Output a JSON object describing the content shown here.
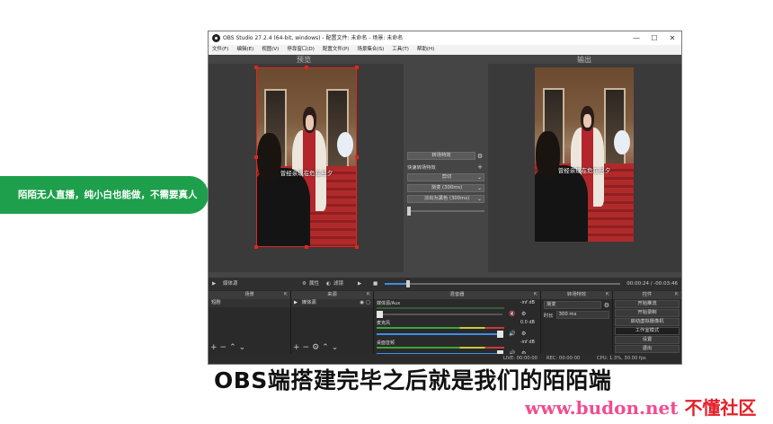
{
  "banner": {
    "text": "陌陌无人直播，纯小白也能做，不需要真人"
  },
  "window": {
    "title": "OBS Studio 27.2.4 (64-bit, windows) - 配置文件: 未命名 - 场景: 未命名",
    "controls": [
      "—",
      "☐",
      "✕"
    ]
  },
  "menu": [
    "文件(F)",
    "编辑(E)",
    "视图(V)",
    "停靠窗口(D)",
    "配置文件(P)",
    "场景集合(S)",
    "工具(T)",
    "帮助(H)"
  ],
  "preview": {
    "label": "预览",
    "subtitle": "曾经亲现在危在旦夕"
  },
  "output": {
    "label": "输出",
    "subtitle": "曾经亲现在危在旦夕"
  },
  "transition": {
    "button": "转场特效",
    "quick": "快速转场特效",
    "items": [
      "剪切",
      "渐变 (300ms)",
      "淡出为黑色 (300ms)"
    ]
  },
  "controls_bar": {
    "source": "媒体源",
    "properties": "属性",
    "filters": "滤镜",
    "time": "00:00:24 / -00:03:46",
    "progress_fraction": 0.1
  },
  "docks": {
    "scenes": {
      "title": "场景",
      "items": [
        "短剧"
      ]
    },
    "sources": {
      "title": "来源",
      "items": [
        "媒体源"
      ]
    },
    "mixer": {
      "title": "混音器",
      "channels": [
        {
          "name": "媒体源/Aux",
          "db": "-inf dB",
          "level": 0.0
        },
        {
          "name": "麦克风",
          "db": "0.0 dB",
          "level": 1.0
        },
        {
          "name": "桌面音频",
          "db": "-inf dB",
          "level": 1.0
        }
      ]
    },
    "transitions": {
      "title": "转场特效",
      "selected": "渐变",
      "duration_label": "时长",
      "duration": "300 ms"
    },
    "controls": {
      "title": "控件",
      "buttons": [
        "开始推流",
        "开始录制",
        "启动虚拟摄像机",
        "工作室模式",
        "设置",
        "退出"
      ]
    }
  },
  "status": {
    "live": "LIVE: 00:00:00",
    "rec": "REC: 00:00:00",
    "cpu": "CPU: 1.3%, 30.00 fps"
  },
  "caption": "OBS端搭建完毕之后就是我们的陌陌端",
  "watermark": {
    "site": "www.budon.net",
    "brand": "不懂社区"
  },
  "colors": {
    "accent_blue": "#3b8ee4",
    "selection_red": "#e0251e",
    "banner_green": "#1e9f4b"
  }
}
